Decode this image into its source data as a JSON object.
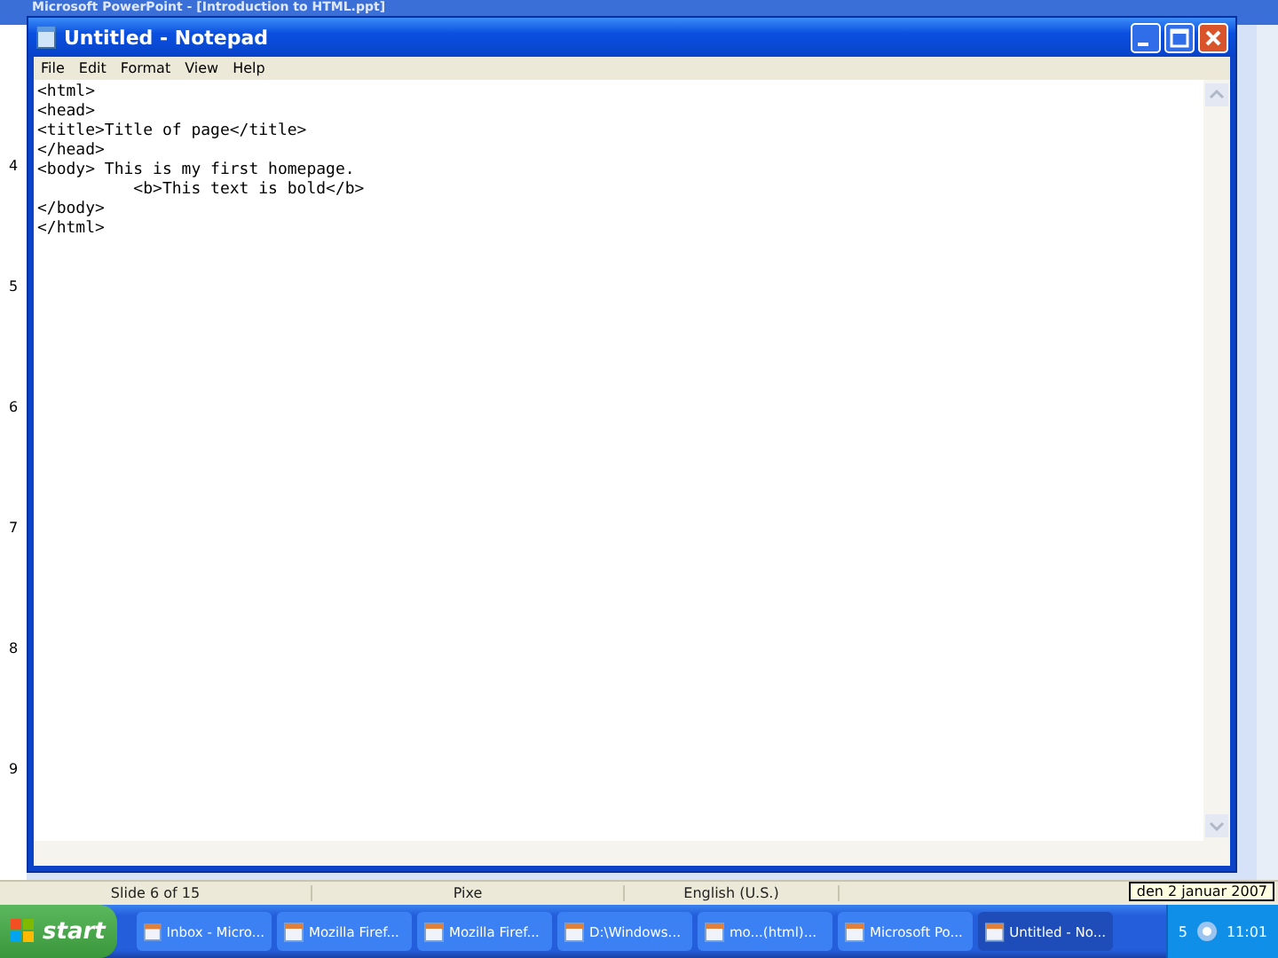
{
  "background_window": {
    "title": "Microsoft PowerPoint - [Introduction to HTML.ppt]",
    "ruler_numbers": [
      "4",
      "5",
      "6",
      "7",
      "8",
      "9"
    ],
    "status_bar": [
      "Slide 6 of 15",
      "Pixe",
      "English (U.S.)"
    ]
  },
  "notepad": {
    "title": "Untitled - Notepad",
    "menu": [
      "File",
      "Edit",
      "Format",
      "View",
      "Help"
    ],
    "lines": [
      "<html>",
      "<head>",
      "<title>Title of page</title>",
      "</head>",
      "<body> This is my first homepage.",
      "          <b>This text is bold</b>",
      "</body>",
      "</html>"
    ]
  },
  "taskbar": {
    "start": "start",
    "items": [
      {
        "label": "Inbox - Micro...",
        "selected": false
      },
      {
        "label": "Mozilla Firef...",
        "selected": false
      },
      {
        "label": "Mozilla Firef...",
        "selected": false
      },
      {
        "label": "D:\\Windows...",
        "selected": false
      },
      {
        "label": "mo...(html)...",
        "selected": false
      },
      {
        "label": "Microsoft Po...",
        "selected": false
      },
      {
        "label": "Untitled - No...",
        "selected": true
      }
    ],
    "tray_count": "5",
    "clock": "11:01",
    "tooltip": "den 2 januar 2007"
  }
}
